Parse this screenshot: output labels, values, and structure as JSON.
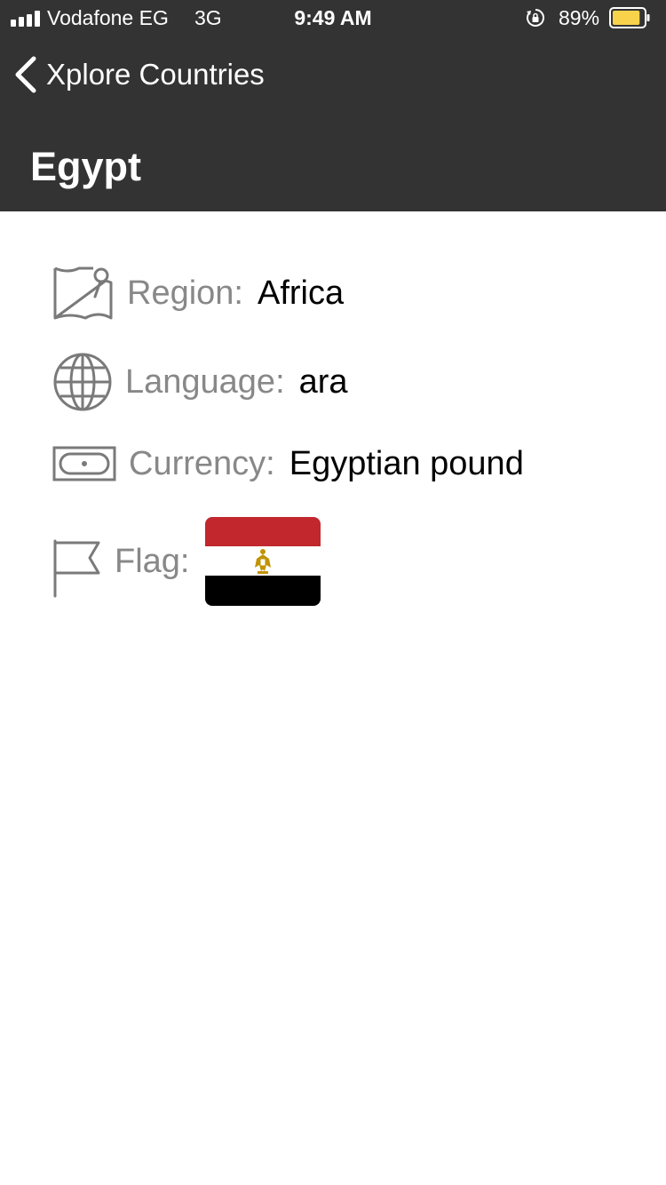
{
  "status_bar": {
    "carrier": "Vodafone EG",
    "network": "3G",
    "time": "9:49 AM",
    "battery_percent": "89%",
    "battery_level": 0.89,
    "battery_color": "#f8d24a"
  },
  "navigation": {
    "back_label": "Xplore Countries",
    "title": "Egypt"
  },
  "details": {
    "region": {
      "label": "Region:",
      "value": "Africa",
      "icon": "map-pin-icon"
    },
    "language": {
      "label": "Language:",
      "value": "ara",
      "icon": "globe-icon"
    },
    "currency": {
      "label": "Currency:",
      "value": "Egyptian pound",
      "icon": "banknote-icon"
    },
    "flag": {
      "label": "Flag:",
      "icon": "flag-icon"
    }
  },
  "colors": {
    "header_bg": "#333333",
    "label_gray": "#888888",
    "icon_gray": "#7a7a7a",
    "flag_red": "#c1272d",
    "flag_white": "#ffffff",
    "flag_black": "#000000",
    "flag_eagle": "#c09300"
  }
}
